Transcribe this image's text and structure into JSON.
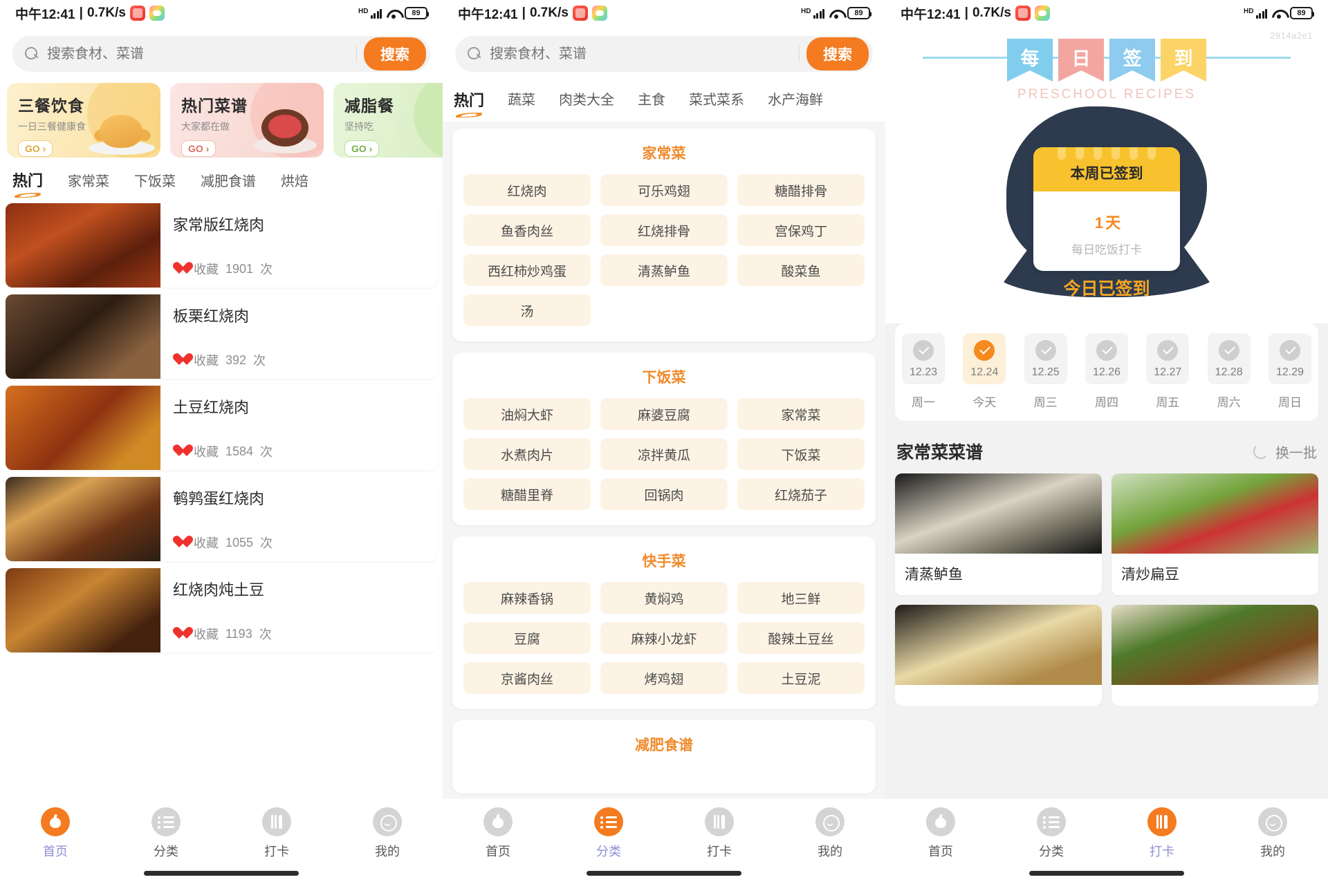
{
  "statusbar": {
    "time": "中午12:41",
    "separator": "|",
    "netspeed": "0.7K/s",
    "hd": "HD",
    "battery": "89"
  },
  "watermark": "2914a2e1",
  "search": {
    "placeholder": "搜索食材、菜谱",
    "button": "搜索",
    "icon": "search-icon"
  },
  "home": {
    "banners": [
      {
        "title": "三餐饮食",
        "subtitle": "一日三餐健康食",
        "go": "GO ›"
      },
      {
        "title": "热门菜谱",
        "subtitle": "大家都在做",
        "go": "GO ›"
      },
      {
        "title": "减脂餐",
        "subtitle": "坚持吃",
        "go": "GO ›"
      }
    ],
    "tabs": [
      "热门",
      "家常菜",
      "下饭菜",
      "减肥食谱",
      "烘焙"
    ],
    "active_tab": "热门",
    "fav_label": "收藏",
    "fav_unit": "次",
    "recipes": [
      {
        "title": "家常版红烧肉",
        "favorites": "1901"
      },
      {
        "title": "板栗红烧肉",
        "favorites": "392"
      },
      {
        "title": "土豆红烧肉",
        "favorites": "1584"
      },
      {
        "title": "鹌鹑蛋红烧肉",
        "favorites": "1055"
      },
      {
        "title": "红烧肉炖土豆",
        "favorites": "1193"
      }
    ]
  },
  "category": {
    "tabs": [
      "热门",
      "蔬菜",
      "肉类大全",
      "主食",
      "菜式菜系",
      "水产海鲜"
    ],
    "active_tab": "热门",
    "groups": [
      {
        "title": "家常菜",
        "items": [
          "红烧肉",
          "可乐鸡翅",
          "糖醋排骨",
          "鱼香肉丝",
          "红烧排骨",
          "宫保鸡丁",
          "西红柿炒鸡蛋",
          "清蒸鲈鱼",
          "酸菜鱼",
          "汤"
        ]
      },
      {
        "title": "下饭菜",
        "items": [
          "油焖大虾",
          "麻婆豆腐",
          "家常菜",
          "水煮肉片",
          "凉拌黄瓜",
          "下饭菜",
          "糖醋里脊",
          "回锅肉",
          "红烧茄子"
        ]
      },
      {
        "title": "快手菜",
        "items": [
          "麻辣香锅",
          "黄焖鸡",
          "地三鲜",
          "豆腐",
          "麻辣小龙虾",
          "酸辣土豆丝",
          "京酱肉丝",
          "烤鸡翅",
          "土豆泥"
        ]
      },
      {
        "title": "减肥食谱",
        "items": []
      }
    ]
  },
  "checkin": {
    "flags": [
      "每",
      "日",
      "签",
      "到"
    ],
    "subtitle": "PRESCHOOL RECIPES",
    "card_head": "本周已签到",
    "days_count": "1",
    "days_unit": "天",
    "card_sub": "每日吃饭打卡",
    "today_signed": "今日已签到",
    "dates": [
      {
        "date": "12.23",
        "week": "周一",
        "checked": false
      },
      {
        "date": "12.24",
        "week": "今天",
        "checked": true
      },
      {
        "date": "12.25",
        "week": "周三",
        "checked": false
      },
      {
        "date": "12.26",
        "week": "周四",
        "checked": false
      },
      {
        "date": "12.27",
        "week": "周五",
        "checked": false
      },
      {
        "date": "12.28",
        "week": "周六",
        "checked": false
      },
      {
        "date": "12.29",
        "week": "周日",
        "checked": false
      }
    ],
    "section_title": "家常菜菜谱",
    "refresh_label": "换一批",
    "cards": [
      {
        "name": "清蒸鲈鱼"
      },
      {
        "name": "清炒扁豆"
      },
      {
        "name": ""
      },
      {
        "name": ""
      }
    ]
  },
  "nav": {
    "items": [
      {
        "label": "首页",
        "icon": "home-icon"
      },
      {
        "label": "分类",
        "icon": "list-icon"
      },
      {
        "label": "打卡",
        "icon": "fork-knife-icon"
      },
      {
        "label": "我的",
        "icon": "profile-icon"
      }
    ],
    "active_panel1": "首页",
    "active_panel2": "分类",
    "active_panel3": "打卡"
  },
  "colors": {
    "accent": "#f47b20",
    "accent_soft": "#f08a2c",
    "active_label": "#8f8fd6",
    "chip_bg": "#fdf3e4",
    "calendar_head": "#f8c22e"
  }
}
